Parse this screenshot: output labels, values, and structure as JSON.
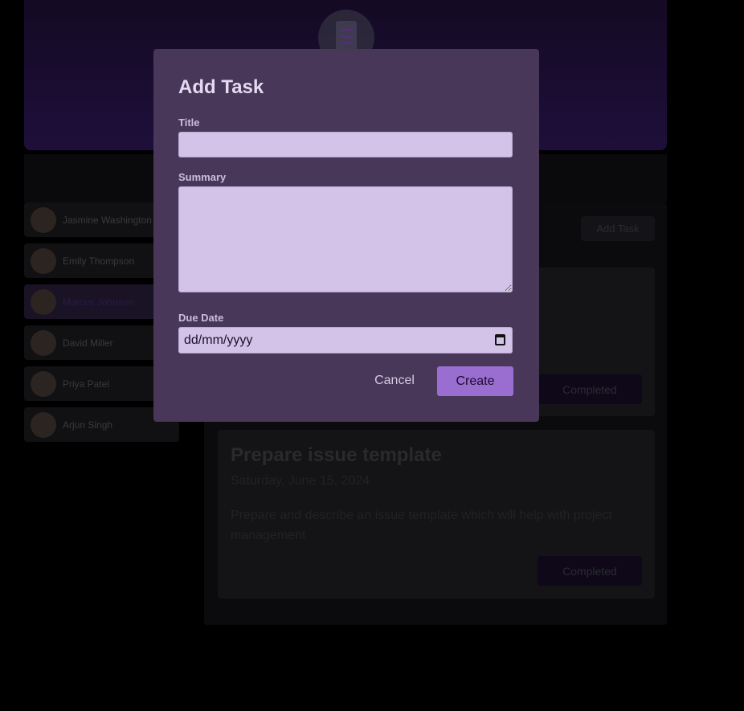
{
  "team": {
    "members": [
      {
        "name": "Jasmine Washington"
      },
      {
        "name": "Emily Thompson"
      },
      {
        "name": "Marcus Johnson"
      },
      {
        "name": "David Miller"
      },
      {
        "name": "Priya Patel"
      },
      {
        "name": "Arjun Singh"
      }
    ],
    "active_member": "Marcus Johnson"
  },
  "main": {
    "add_task_label": "Add Task",
    "tasks": [
      {
        "title": "",
        "date": "",
        "summary": "",
        "status_label": "Completed"
      },
      {
        "title": "Prepare issue template",
        "date": "Saturday, June 15, 2024",
        "summary": "Prepare and describe an issue template which will help with project management",
        "status_label": "Completed"
      }
    ]
  },
  "modal": {
    "heading": "Add Task",
    "title_label": "Title",
    "title_value": "",
    "summary_label": "Summary",
    "summary_value": "",
    "due_date_label": "Due Date",
    "due_date_placeholder": "dd/mm/yyyy",
    "cancel_label": "Cancel",
    "create_label": "Create"
  },
  "colors": {
    "modal_bg": "#483758",
    "accent": "#9a6dd0",
    "field_bg": "#d3c3e8"
  }
}
